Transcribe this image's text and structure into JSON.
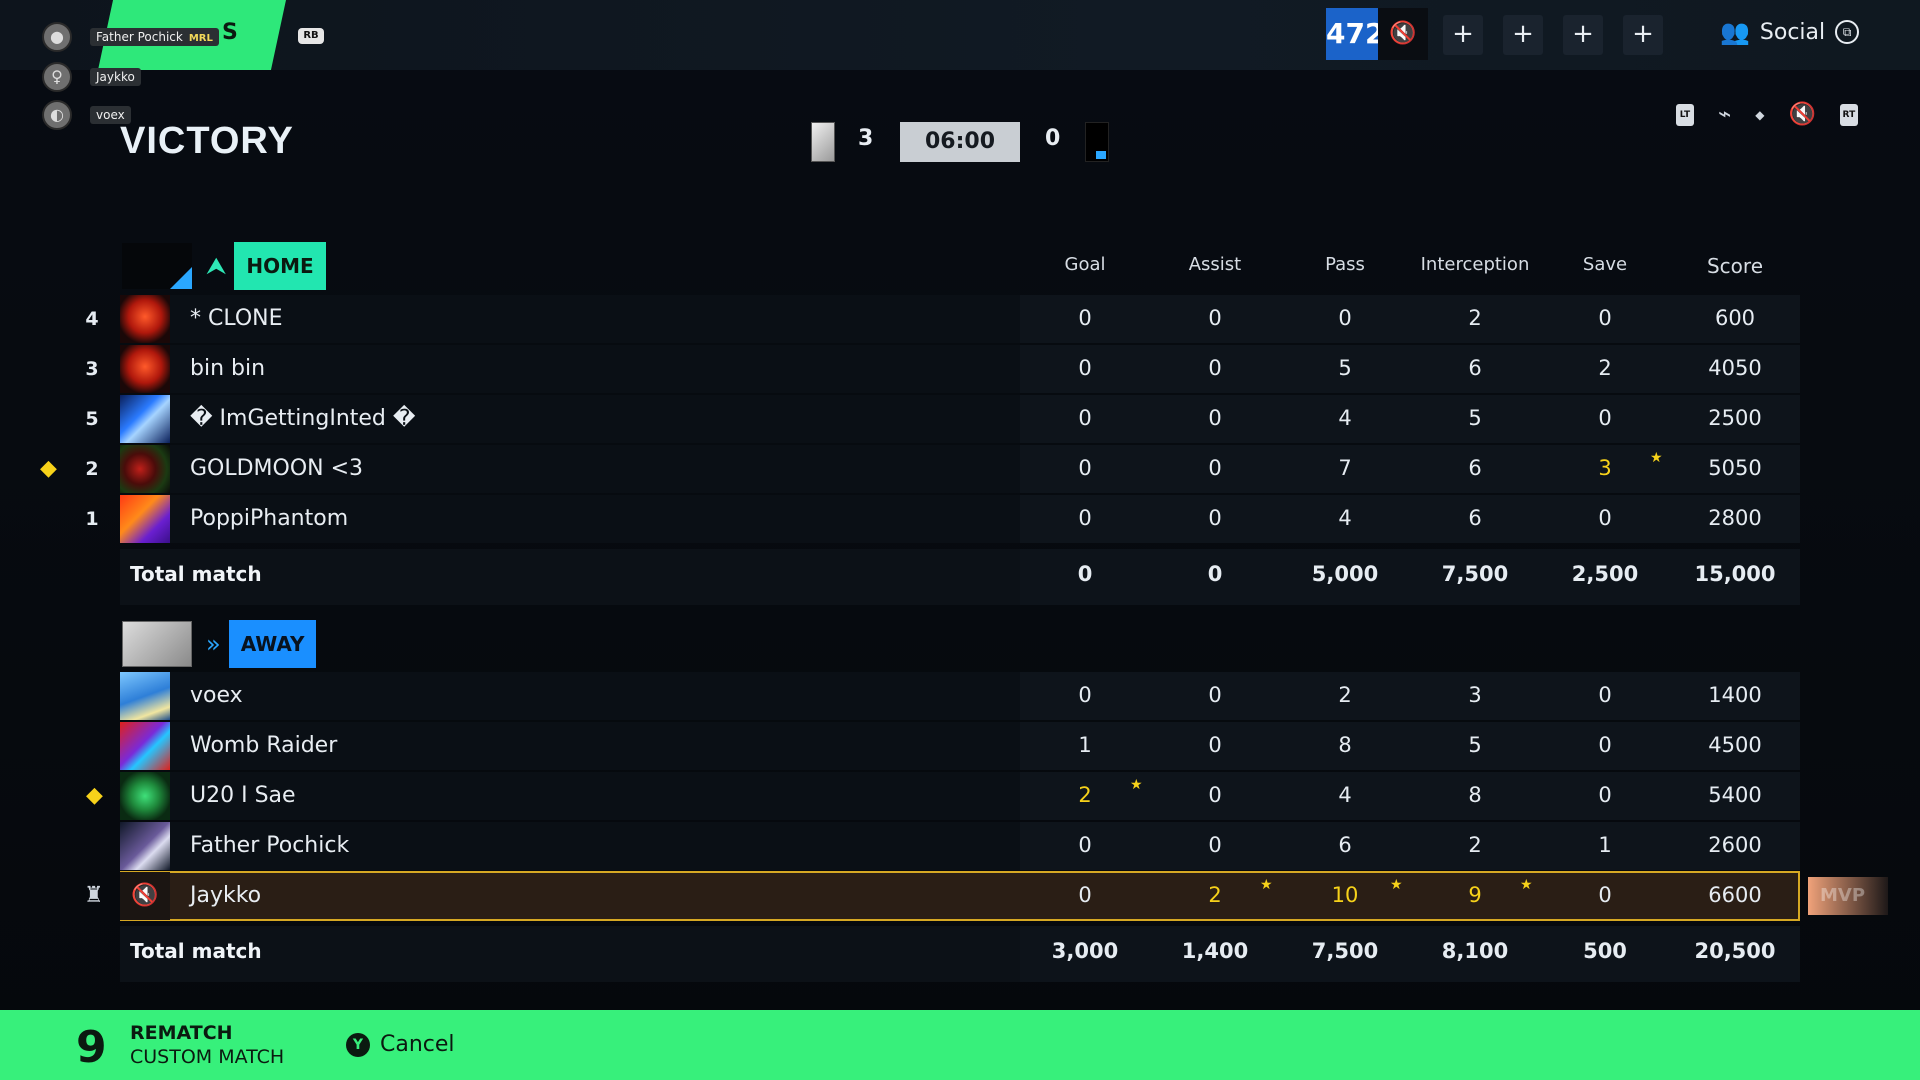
{
  "party": [
    {
      "name": "Father Pochick",
      "tag": "MRL"
    },
    {
      "name": "Jaykko",
      "tag": ""
    },
    {
      "name": "voex",
      "tag": ""
    }
  ],
  "header": {
    "tab_partial_text": "S",
    "rb_label": "RB",
    "level": "472",
    "social_label": "Social"
  },
  "match": {
    "result": "VICTORY",
    "home_score": "3",
    "timer": "06:00",
    "away_score": "0",
    "controls": {
      "lt": "LT",
      "rt": "RT"
    }
  },
  "columns": [
    "Goal",
    "Assist",
    "Pass",
    "Interception",
    "Save",
    "Score"
  ],
  "home": {
    "tag": "HOME",
    "players": [
      {
        "rank": "4",
        "name": "* CLONE",
        "stats": [
          "0",
          "0",
          "0",
          "2",
          "0",
          "600"
        ]
      },
      {
        "rank": "3",
        "name": "bin bin",
        "stats": [
          "0",
          "0",
          "5",
          "6",
          "2",
          "4050"
        ]
      },
      {
        "rank": "5",
        "name": "� ImGettingInted �",
        "stats": [
          "0",
          "0",
          "4",
          "5",
          "0",
          "2500"
        ]
      },
      {
        "rank": "2",
        "name": "GOLDMOON <3",
        "stats": [
          "0",
          "0",
          "7",
          "6",
          "3",
          "5050"
        ]
      },
      {
        "rank": "1",
        "name": "PoppiPhantom",
        "stats": [
          "0",
          "0",
          "4",
          "6",
          "0",
          "2800"
        ]
      }
    ],
    "total_label": "Total match",
    "totals": [
      "0",
      "0",
      "5,000",
      "7,500",
      "2,500",
      "15,000"
    ]
  },
  "away": {
    "tag": "AWAY",
    "players": [
      {
        "name": "voex",
        "stats": [
          "0",
          "0",
          "2",
          "3",
          "0",
          "1400"
        ]
      },
      {
        "name": "Womb Raider",
        "stats": [
          "1",
          "0",
          "8",
          "5",
          "0",
          "4500"
        ]
      },
      {
        "name": "U20 I Sae",
        "stats": [
          "2",
          "0",
          "4",
          "8",
          "0",
          "5400"
        ]
      },
      {
        "name": "Father Pochick",
        "stats": [
          "0",
          "0",
          "6",
          "2",
          "1",
          "2600"
        ]
      },
      {
        "name": "Jaykko",
        "stats": [
          "0",
          "2",
          "10",
          "9",
          "0",
          "6600"
        ]
      }
    ],
    "total_label": "Total match",
    "totals": [
      "3,000",
      "1,400",
      "7,500",
      "8,100",
      "500",
      "20,500"
    ]
  },
  "mvp_label": "MVP",
  "bottom": {
    "countdown": "9",
    "rematch": "REMATCH",
    "custom_match": "CUSTOM MATCH",
    "y_button": "Y",
    "cancel": "Cancel"
  },
  "colors": {
    "accent_green": "#37f07b",
    "home_teal": "#22e6b0",
    "away_blue": "#1a8fff",
    "gold": "#f7d21a"
  }
}
